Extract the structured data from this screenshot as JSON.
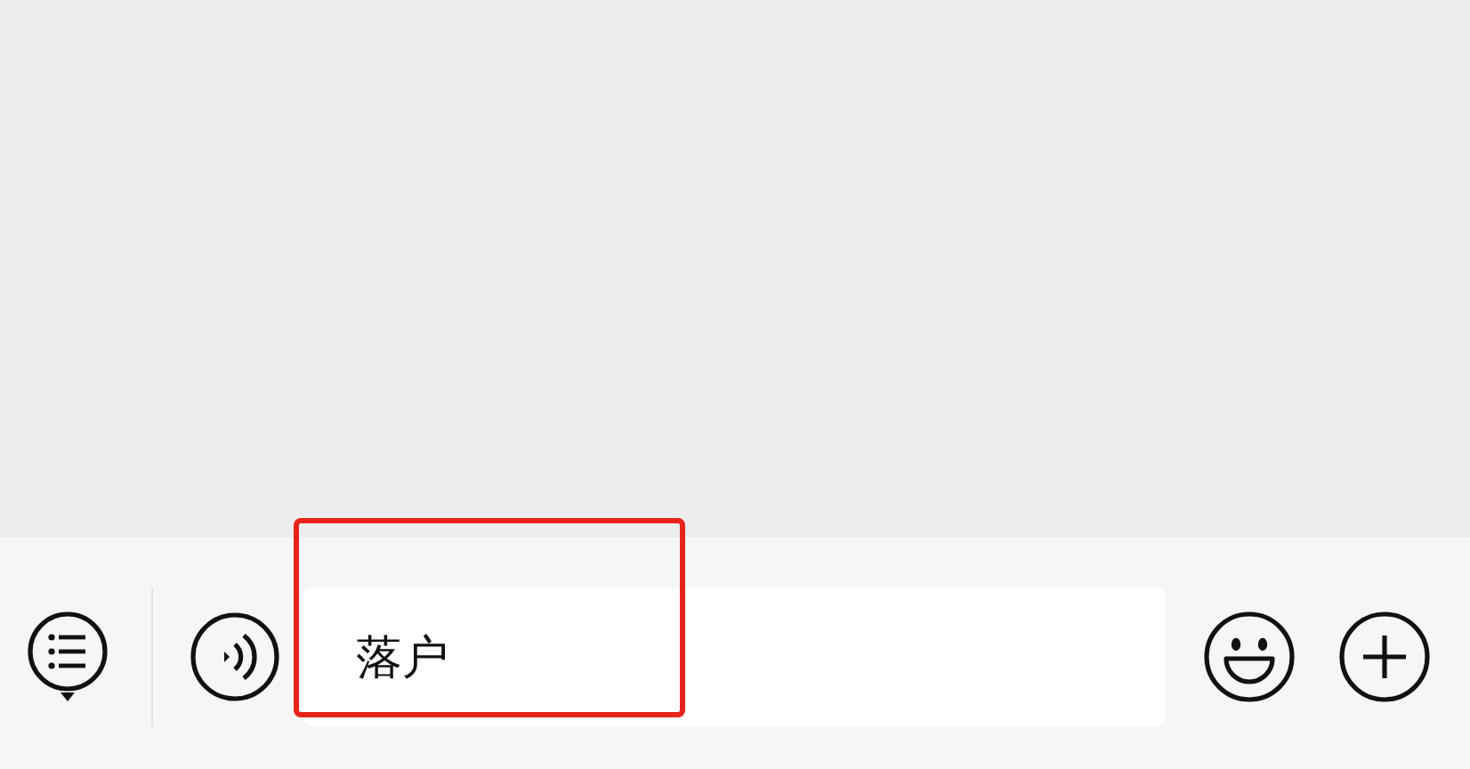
{
  "input_bar": {
    "value": "落户"
  }
}
